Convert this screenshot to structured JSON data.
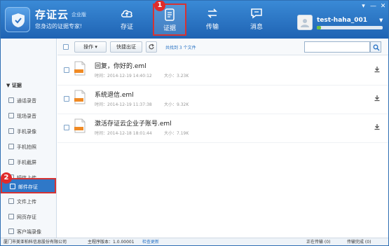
{
  "header": {
    "brand_name": "存证云",
    "brand_edition": "企业版",
    "brand_slogan": "您身边的证据专家!",
    "nav": [
      {
        "label": "存证",
        "icon": "cloud-upload-icon"
      },
      {
        "label": "证据",
        "icon": "document-icon",
        "active": true
      },
      {
        "label": "传输",
        "icon": "transfer-icon"
      },
      {
        "label": "消息",
        "icon": "message-icon"
      }
    ],
    "user": {
      "name": "test-haha_001",
      "caret": "▼",
      "storage_fraction": 0.06
    },
    "window_controls": [
      "▾",
      "—",
      "✕"
    ]
  },
  "callouts": [
    "1",
    "2"
  ],
  "sidebar": {
    "group_label": "▼ 证据",
    "items": [
      {
        "label": "通话录音",
        "icon": "microphone-icon"
      },
      {
        "label": "现场录音",
        "icon": "recorder-icon"
      },
      {
        "label": "手机录像",
        "icon": "video-icon"
      },
      {
        "label": "手机拍照",
        "icon": "camera-icon"
      },
      {
        "label": "手机截屏",
        "icon": "screenshot-icon"
      },
      {
        "label": "短信上传",
        "icon": "sms-icon"
      },
      {
        "label": "邮件存证",
        "icon": "mail-icon",
        "active": true
      },
      {
        "label": "文件上传",
        "icon": "file-upload-icon"
      },
      {
        "label": "网页存证",
        "icon": "web-icon"
      },
      {
        "label": "客户端录像",
        "icon": "client-record-icon"
      }
    ]
  },
  "toolbar": {
    "operate_label": "操作 ▾",
    "export_label": "快捷出证",
    "refresh_icon": "refresh-icon",
    "file_count": "共找到 3 个文件",
    "search_placeholder": ""
  },
  "files": [
    {
      "name": "回复，你好的.eml",
      "time": "时间：2014-12-19 14:40:12",
      "size": "大小：3.23K"
    },
    {
      "name": "系统退信.eml",
      "time": "时间：2014-12-19 11:37:38",
      "size": "大小：9.32K"
    },
    {
      "name": "激活存证云企业子账号.eml",
      "time": "时间：2014-12-18 18:01:44",
      "size": "大小：7.19K"
    }
  ],
  "statusbar": {
    "company": "厦门市美亚柏科信息股份有限公司",
    "version": "主程序版本：1.0.00001",
    "check_update": "检查更新",
    "uploading": "正在传输 (0)",
    "done": "传输完成 (0)"
  },
  "colors": {
    "header": "#2a74c4",
    "accent": "#2f78c8",
    "callout": "#e02b2b",
    "link": "#2b74c4"
  }
}
